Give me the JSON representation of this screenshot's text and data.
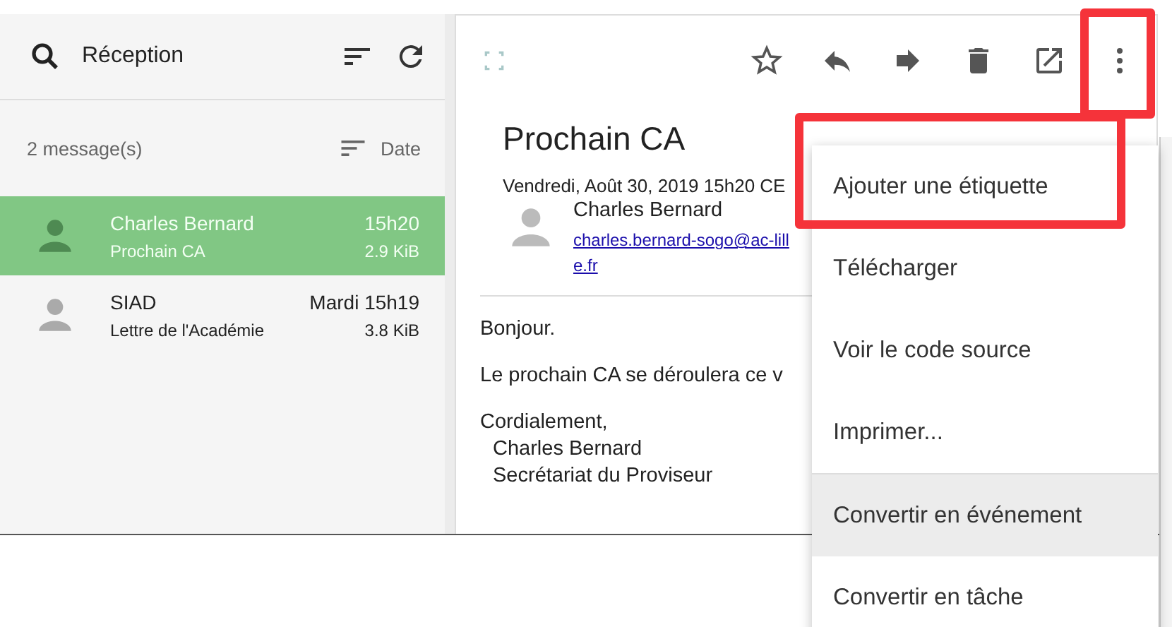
{
  "folder": {
    "title": "Réception"
  },
  "list_header": {
    "count": "2 message(s)",
    "sort": "Date"
  },
  "messages": [
    {
      "sender": "Charles Bernard",
      "subject": "Prochain CA",
      "time": "15h20",
      "size": "2.9 KiB",
      "selected": true
    },
    {
      "sender": "SIAD",
      "subject": "Lettre de l'Académie",
      "time": "Mardi 15h19",
      "size": "3.8 KiB",
      "selected": false
    }
  ],
  "message": {
    "subject": "Prochain CA",
    "date": "Vendredi, Août 30, 2019 15h20 CE",
    "from_name": "Charles Bernard",
    "from_email": "charles.bernard-sogo@ac-lille.fr",
    "body": [
      "Bonjour.",
      "Le prochain CA se déroulera ce v"
    ],
    "closing": "Cordialement,",
    "signature": [
      "Charles Bernard",
      "Secrétariat du Proviseur"
    ]
  },
  "menu": {
    "groups": [
      [
        {
          "label": "Ajouter une étiquette",
          "highlighted": false
        },
        {
          "label": "Télécharger",
          "highlighted": false
        },
        {
          "label": "Voir le code source",
          "highlighted": false
        },
        {
          "label": "Imprimer...",
          "highlighted": false
        }
      ],
      [
        {
          "label": "Convertir en événement",
          "highlighted": true
        },
        {
          "label": "Convertir en tâche",
          "highlighted": false
        }
      ]
    ]
  }
}
